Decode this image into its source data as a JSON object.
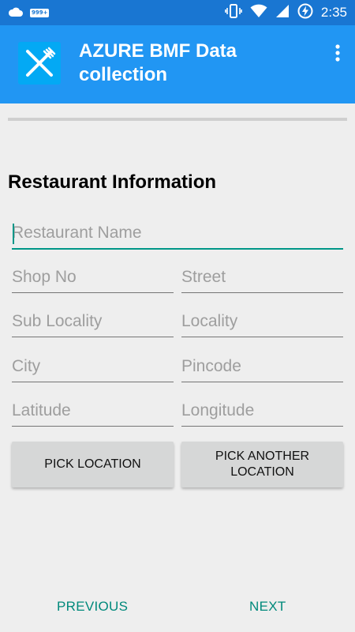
{
  "status_bar": {
    "notification_badge": "999+",
    "time": "2:35",
    "icons": [
      "cloud-icon",
      "notification-badge-icon",
      "vibrate-icon",
      "wifi-icon",
      "signal-icon",
      "battery-charging-icon"
    ]
  },
  "app_bar": {
    "title": "AZURE BMF Data collection",
    "logo_icon": "fork-knife-icon",
    "menu_icon": "more-vert-icon",
    "color": "#2196f3",
    "status_color": "#1976d2"
  },
  "progress": {
    "fraction": 0
  },
  "form": {
    "section_title": "Restaurant Information",
    "fields": {
      "restaurant_name": {
        "placeholder": "Restaurant Name",
        "value": ""
      },
      "shop_no": {
        "placeholder": "Shop No",
        "value": ""
      },
      "street": {
        "placeholder": "Street",
        "value": ""
      },
      "sub_locality": {
        "placeholder": "Sub Locality",
        "value": ""
      },
      "locality": {
        "placeholder": "Locality",
        "value": ""
      },
      "city": {
        "placeholder": "City",
        "value": ""
      },
      "pincode": {
        "placeholder": "Pincode",
        "value": ""
      },
      "latitude": {
        "placeholder": "Latitude",
        "value": ""
      },
      "longitude": {
        "placeholder": "Longitude",
        "value": ""
      }
    },
    "buttons": {
      "pick_location": "PICK LOCATION",
      "pick_another_location": "PICK ANOTHER LOCATION"
    }
  },
  "navigation": {
    "previous": "PREVIOUS",
    "next": "NEXT",
    "accent": "#00897b"
  }
}
